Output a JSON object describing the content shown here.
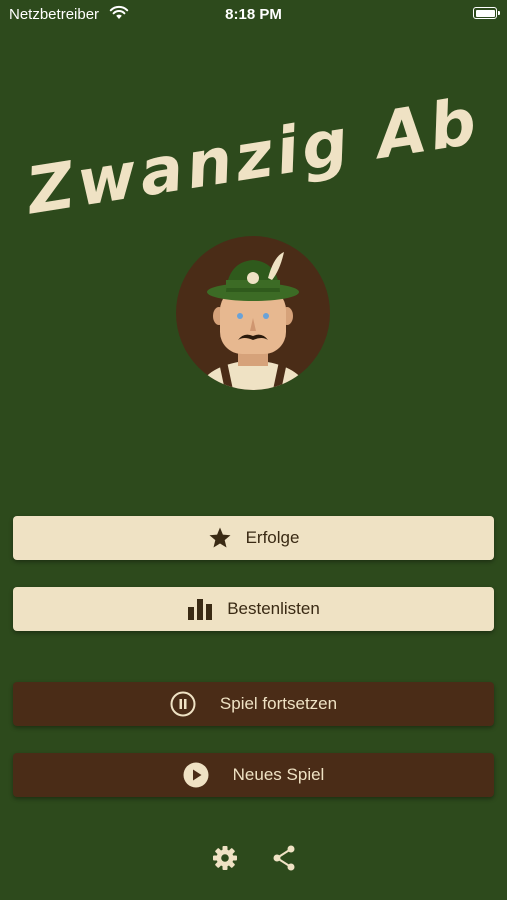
{
  "status_bar": {
    "carrier": "Netzbetreiber",
    "time": "8:18 PM",
    "wifi_icon": "wifi-icon",
    "battery_level": 1.0
  },
  "app": {
    "title": "Zwanzig Ab",
    "mascot": "hunter-mascot"
  },
  "menu": {
    "achievements": {
      "label": "Erfolge",
      "icon": "star-icon"
    },
    "leaderboards": {
      "label": "Bestenlisten",
      "icon": "bar-chart-icon"
    },
    "continue_game": {
      "label": "Spiel fortsetzen",
      "icon": "pause-icon"
    },
    "new_game": {
      "label": "Neues Spiel",
      "icon": "play-icon"
    }
  },
  "footer": {
    "settings_icon": "gear-icon",
    "share_icon": "share-icon"
  },
  "colors": {
    "background": "#2d4a1c",
    "light_button": "#efe2c4",
    "dark_button": "#4a2c17",
    "title": "#efe2c4"
  }
}
